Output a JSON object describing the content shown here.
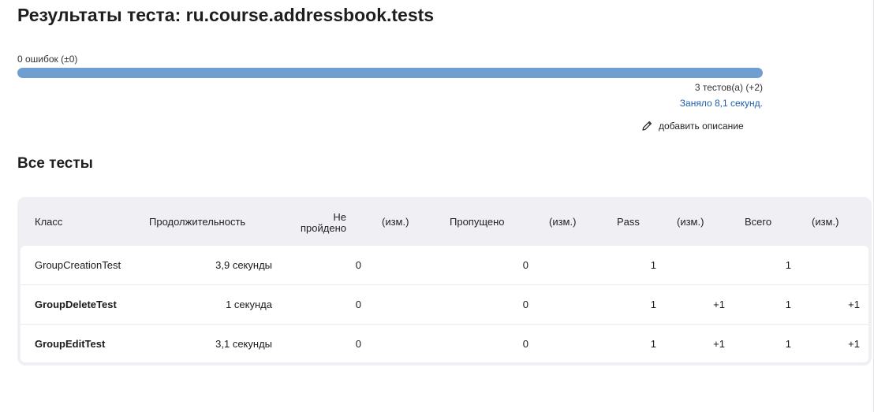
{
  "page": {
    "title": "Результаты теста: ru.course.addressbook.tests",
    "fail_count": "0 ошибок (±0)",
    "tests_count": "3 тестов(а) (+2)",
    "duration": "Заняло 8,1 секунд.",
    "add_description": "добавить описание",
    "pass_fraction": 1.0
  },
  "section": {
    "title": "Все тесты"
  },
  "colors": {
    "bar": "#6f9fd0",
    "link": "#1f5fa8"
  },
  "table": {
    "headers": {
      "klass": "Класс",
      "duration": "Продолжительность",
      "failed_line1": "Не",
      "failed_line2": "пройдено",
      "failed_diff": "(изм.)",
      "skipped": "Пропущено",
      "skipped_diff": "(изм.)",
      "pass": "Pass",
      "pass_diff": "(изм.)",
      "total": "Всего",
      "total_diff": "(изм.)"
    },
    "rows": [
      {
        "klass": "GroupCreationTest",
        "duration": "3,9 секунды",
        "failed": "0",
        "failed_diff": "",
        "skipped": "0",
        "skipped_diff": "",
        "pass": "1",
        "pass_diff": "",
        "total": "1",
        "total_diff": ""
      },
      {
        "klass": "GroupDeleteTest",
        "duration": "1 секунда",
        "failed": "0",
        "failed_diff": "",
        "skipped": "0",
        "skipped_diff": "",
        "pass": "1",
        "pass_diff": "+1",
        "total": "1",
        "total_diff": "+1"
      },
      {
        "klass": "GroupEditTest",
        "duration": "3,1 секунды",
        "failed": "0",
        "failed_diff": "",
        "skipped": "0",
        "skipped_diff": "",
        "pass": "1",
        "pass_diff": "+1",
        "total": "1",
        "total_diff": "+1"
      }
    ]
  }
}
